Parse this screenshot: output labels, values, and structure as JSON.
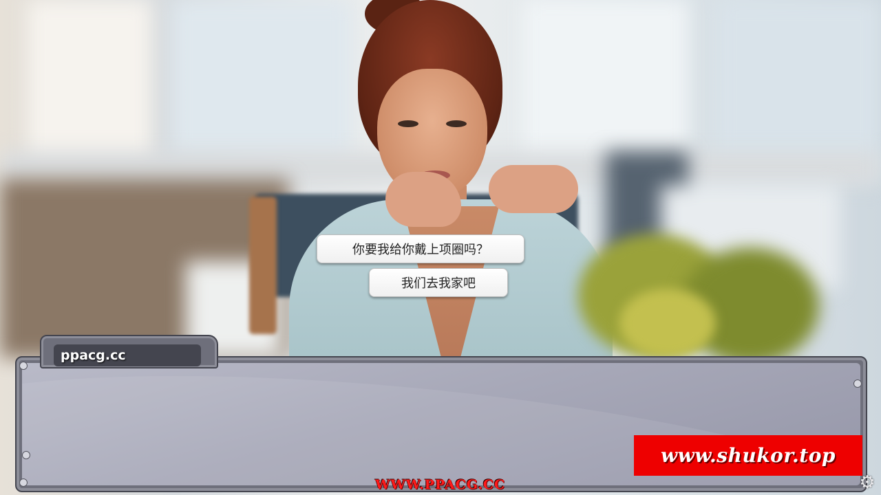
{
  "choices": [
    {
      "label": "你要我给你戴上项圈吗？"
    },
    {
      "label": "我们去我家吧"
    }
  ],
  "dialog": {
    "speaker": "ppacg.cc",
    "text": ""
  },
  "watermarks": {
    "site_banner": "www.shukor.top",
    "bottom_banner": "WWW.PPACG.CC"
  },
  "icons": {
    "settings": "gear-icon"
  },
  "colors": {
    "dialog_panel": "#a7a8b8",
    "dialog_frame": "#6e6f7b",
    "watermark_red": "#ee0000"
  }
}
